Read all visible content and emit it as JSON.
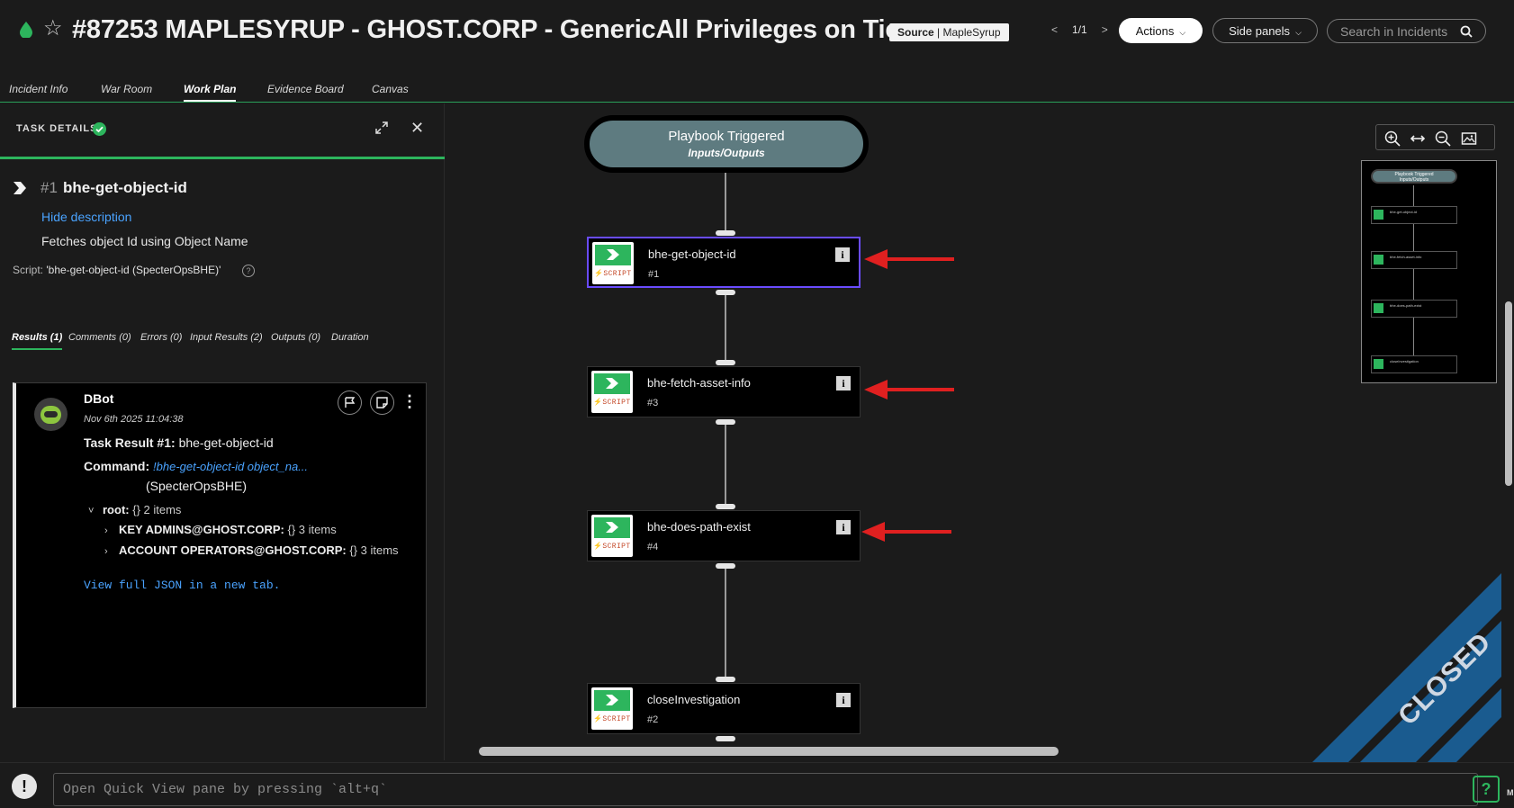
{
  "header": {
    "title": "#87253  MAPLESYRUP - GHOST.CORP - GenericAll Privileges on Tier ...",
    "source_label": "Source",
    "source_value": "MapleSyrup",
    "pager_prev": "<",
    "pager_text": "1/1",
    "pager_next": ">",
    "actions_label": "Actions",
    "side_panels_label": "Side panels",
    "search_placeholder": "Search in Incidents"
  },
  "tabs": [
    {
      "label": "Incident Info",
      "active": false
    },
    {
      "label": "War Room",
      "active": false
    },
    {
      "label": "Work Plan",
      "active": true
    },
    {
      "label": "Evidence Board",
      "active": false
    },
    {
      "label": "Canvas",
      "active": false
    }
  ],
  "task": {
    "panel_title": "TASK DETAILS",
    "num": "#1",
    "name": "bhe-get-object-id",
    "hide_description": "Hide description",
    "description": "Fetches object Id using Object Name",
    "script_label": "Script:",
    "script_value": "'bhe-get-object-id (SpecterOpsBHE)'",
    "help": "?"
  },
  "result_tabs": [
    {
      "label": "Results (1)",
      "active": true
    },
    {
      "label": "Comments (0)",
      "active": false
    },
    {
      "label": "Errors (0)",
      "active": false
    },
    {
      "label": "Input Results (2)",
      "active": false
    },
    {
      "label": "Outputs (0)",
      "active": false
    },
    {
      "label": "Duration",
      "active": false
    }
  ],
  "result": {
    "author": "DBot",
    "date": "Nov 6th 2025 11:04:38",
    "title_label": "Task Result  #1:",
    "title_value": "bhe-get-object-id",
    "command_label": "Command:",
    "command_value": "!bhe-get-object-id object_na...",
    "command_source": "(SpecterOpsBHE)",
    "tree": [
      {
        "key": "root:",
        "meta": "{} 2 items",
        "toggle": "˅"
      },
      {
        "key": "KEY ADMINS@GHOST.CORP:",
        "meta": "{} 3 items",
        "toggle": "›"
      },
      {
        "key": "ACCOUNT OPERATORS@GHOST.CORP:",
        "meta": "{} 3 items",
        "toggle": "›"
      }
    ],
    "view_json": "View full JSON in a new tab."
  },
  "playbook": {
    "start_title": "Playbook Triggered",
    "start_subtitle": "Inputs/Outputs",
    "node_type": "SCRIPT",
    "nodes": [
      {
        "name": "bhe-get-object-id",
        "num": "#1",
        "selected": true,
        "arrow": true
      },
      {
        "name": "bhe-fetch-asset-info",
        "num": "#3",
        "selected": false,
        "arrow": true
      },
      {
        "name": "bhe-does-path-exist",
        "num": "#4",
        "selected": false,
        "arrow": true
      },
      {
        "name": "closeInvestigation",
        "num": "#2",
        "selected": false,
        "arrow": false
      }
    ],
    "info_glyph": "i"
  },
  "minimap": {
    "start_title": "Playbook Triggered",
    "start_subtitle": "Inputs/Outputs",
    "nodes": [
      "bhe-get-object-id",
      "bhe-fetch-asset-info",
      "bhe-does-path-exist",
      "closeInvestigation"
    ]
  },
  "status_ribbon": "CLOSED",
  "bottom": {
    "alert": "!",
    "quickview_placeholder": "Open Quick View pane by pressing `alt+q`",
    "markdown_icon": "M↓",
    "help": "?"
  },
  "colors": {
    "accent_green": "#2db55d",
    "link_blue": "#4aa3ff",
    "selected_node": "#6a4cff",
    "arrow_red": "#e02020",
    "ribbon_blue": "#1a5b8f"
  }
}
